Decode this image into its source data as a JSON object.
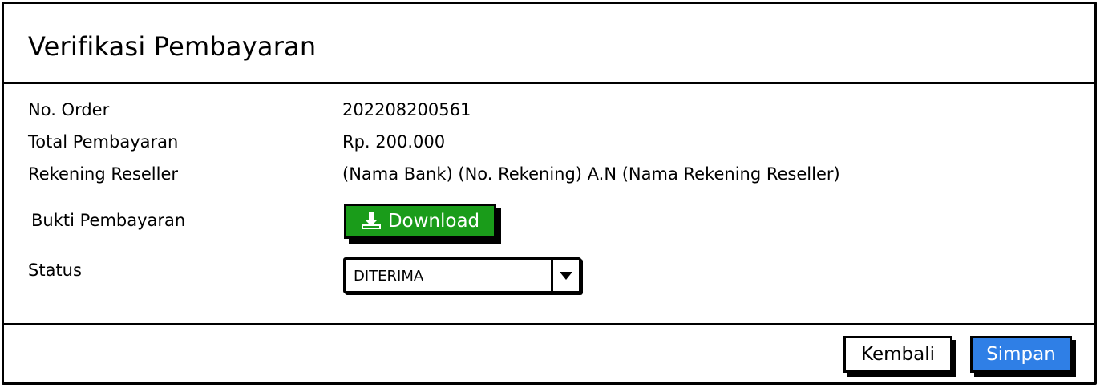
{
  "dialog": {
    "title": "Verifikasi Pembayaran"
  },
  "fields": {
    "order_label": "No. Order",
    "order_value": "202208200561",
    "total_label": "Total Pembayaran",
    "total_value": "Rp. 200.000",
    "rekening_label": "Rekening Reseller",
    "rekening_value": "(Nama Bank) (No. Rekening) A.N (Nama Rekening Reseller)",
    "bukti_label": "Bukti Pembayaran",
    "download_label": "Download",
    "status_label": "Status",
    "status_value": "DITERIMA"
  },
  "footer": {
    "back_label": "Kembali",
    "save_label": "Simpan"
  },
  "colors": {
    "download": "#1a9c1a",
    "save": "#2f7fe6"
  }
}
